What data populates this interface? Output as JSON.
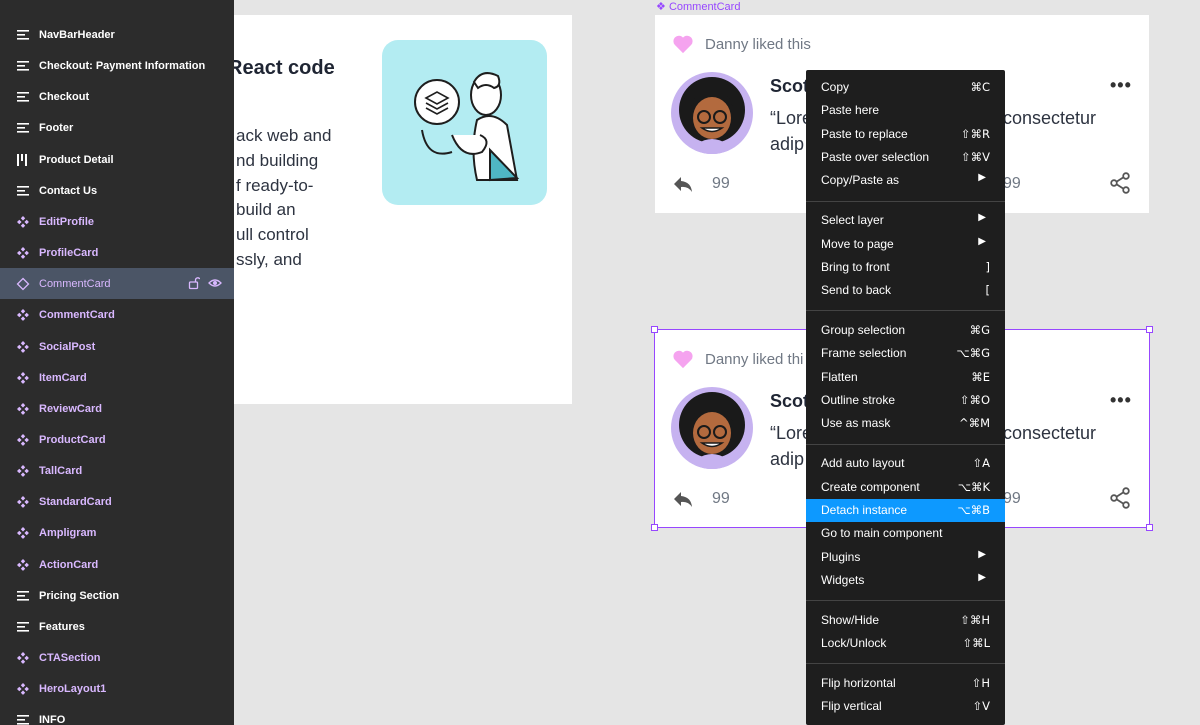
{
  "layers": [
    {
      "label": "NavBarHeader",
      "type": "frame"
    },
    {
      "label": "Checkout: Payment Information",
      "type": "frame"
    },
    {
      "label": "Checkout",
      "type": "frame"
    },
    {
      "label": "Footer",
      "type": "frame"
    },
    {
      "label": "Product Detail",
      "type": "columns"
    },
    {
      "label": "Contact Us",
      "type": "frame"
    },
    {
      "label": "EditProfile",
      "type": "component"
    },
    {
      "label": "ProfileCard",
      "type": "component"
    },
    {
      "label": "CommentCard",
      "type": "instance",
      "selected": true
    },
    {
      "label": "CommentCard",
      "type": "component"
    },
    {
      "label": "SocialPost",
      "type": "component"
    },
    {
      "label": "ItemCard",
      "type": "component"
    },
    {
      "label": "ReviewCard",
      "type": "component"
    },
    {
      "label": "ProductCard",
      "type": "component"
    },
    {
      "label": "TallCard",
      "type": "component"
    },
    {
      "label": "StandardCard",
      "type": "component"
    },
    {
      "label": "Ampligram",
      "type": "component"
    },
    {
      "label": "ActionCard",
      "type": "component"
    },
    {
      "label": "Pricing Section",
      "type": "frame"
    },
    {
      "label": "Features",
      "type": "frame"
    },
    {
      "label": "CTASection",
      "type": "component"
    },
    {
      "label": "HeroLayout1",
      "type": "component"
    },
    {
      "label": "INFO",
      "type": "frame"
    }
  ],
  "hero": {
    "title": "React code",
    "lines": [
      "ack web and",
      "nd building",
      "f ready-to-",
      "build an",
      "ull control",
      "ssly, and"
    ]
  },
  "canvas": {
    "component_label": "CommentCard"
  },
  "comment_card": {
    "liked": "Danny liked this",
    "liked_cut": "Danny liked thi",
    "author": "Scot",
    "body_a": "“Lore",
    "body_b": "adip",
    "body_right": "consectetur",
    "replies": "99",
    "shares_cut": "99",
    "more": "•••"
  },
  "colors": {
    "panel_bg": "#2c2c2c",
    "component_purple": "#d9b8ff",
    "selection": "#9747ff",
    "menu_bg": "#1e1e1e",
    "menu_highlight": "#0d99ff",
    "hero_tile": "#b3ecf2",
    "heart": "#f5a3ef",
    "avatar_ring": "#c6b2f0"
  },
  "context_menu": {
    "items": [
      {
        "label": "Copy",
        "shortcut": "⌘C"
      },
      {
        "label": "Paste here",
        "shortcut": ""
      },
      {
        "label": "Paste to replace",
        "shortcut": "⇧⌘R"
      },
      {
        "label": "Paste over selection",
        "shortcut": "⇧⌘V"
      },
      {
        "label": "Copy/Paste as",
        "shortcut": "",
        "submenu": true
      },
      {
        "separator": true
      },
      {
        "label": "Select layer",
        "shortcut": "",
        "submenu": true
      },
      {
        "label": "Move to page",
        "shortcut": "",
        "submenu": true
      },
      {
        "label": "Bring to front",
        "shortcut": "]"
      },
      {
        "label": "Send to back",
        "shortcut": "["
      },
      {
        "separator": true
      },
      {
        "label": "Group selection",
        "shortcut": "⌘G"
      },
      {
        "label": "Frame selection",
        "shortcut": "⌥⌘G"
      },
      {
        "label": "Flatten",
        "shortcut": "⌘E"
      },
      {
        "label": "Outline stroke",
        "shortcut": "⇧⌘O"
      },
      {
        "label": "Use as mask",
        "shortcut": "^⌘M"
      },
      {
        "separator": true
      },
      {
        "label": "Add auto layout",
        "shortcut": "⇧A"
      },
      {
        "label": "Create component",
        "shortcut": "⌥⌘K"
      },
      {
        "label": "Detach instance",
        "shortcut": "⌥⌘B",
        "highlighted": true
      },
      {
        "label": "Go to main component",
        "shortcut": ""
      },
      {
        "label": "Plugins",
        "shortcut": "",
        "submenu": true
      },
      {
        "label": "Widgets",
        "shortcut": "",
        "submenu": true
      },
      {
        "separator": true
      },
      {
        "label": "Show/Hide",
        "shortcut": "⇧⌘H"
      },
      {
        "label": "Lock/Unlock",
        "shortcut": "⇧⌘L"
      },
      {
        "separator": true
      },
      {
        "label": "Flip horizontal",
        "shortcut": "⇧H"
      },
      {
        "label": "Flip vertical",
        "shortcut": "⇧V"
      }
    ]
  }
}
